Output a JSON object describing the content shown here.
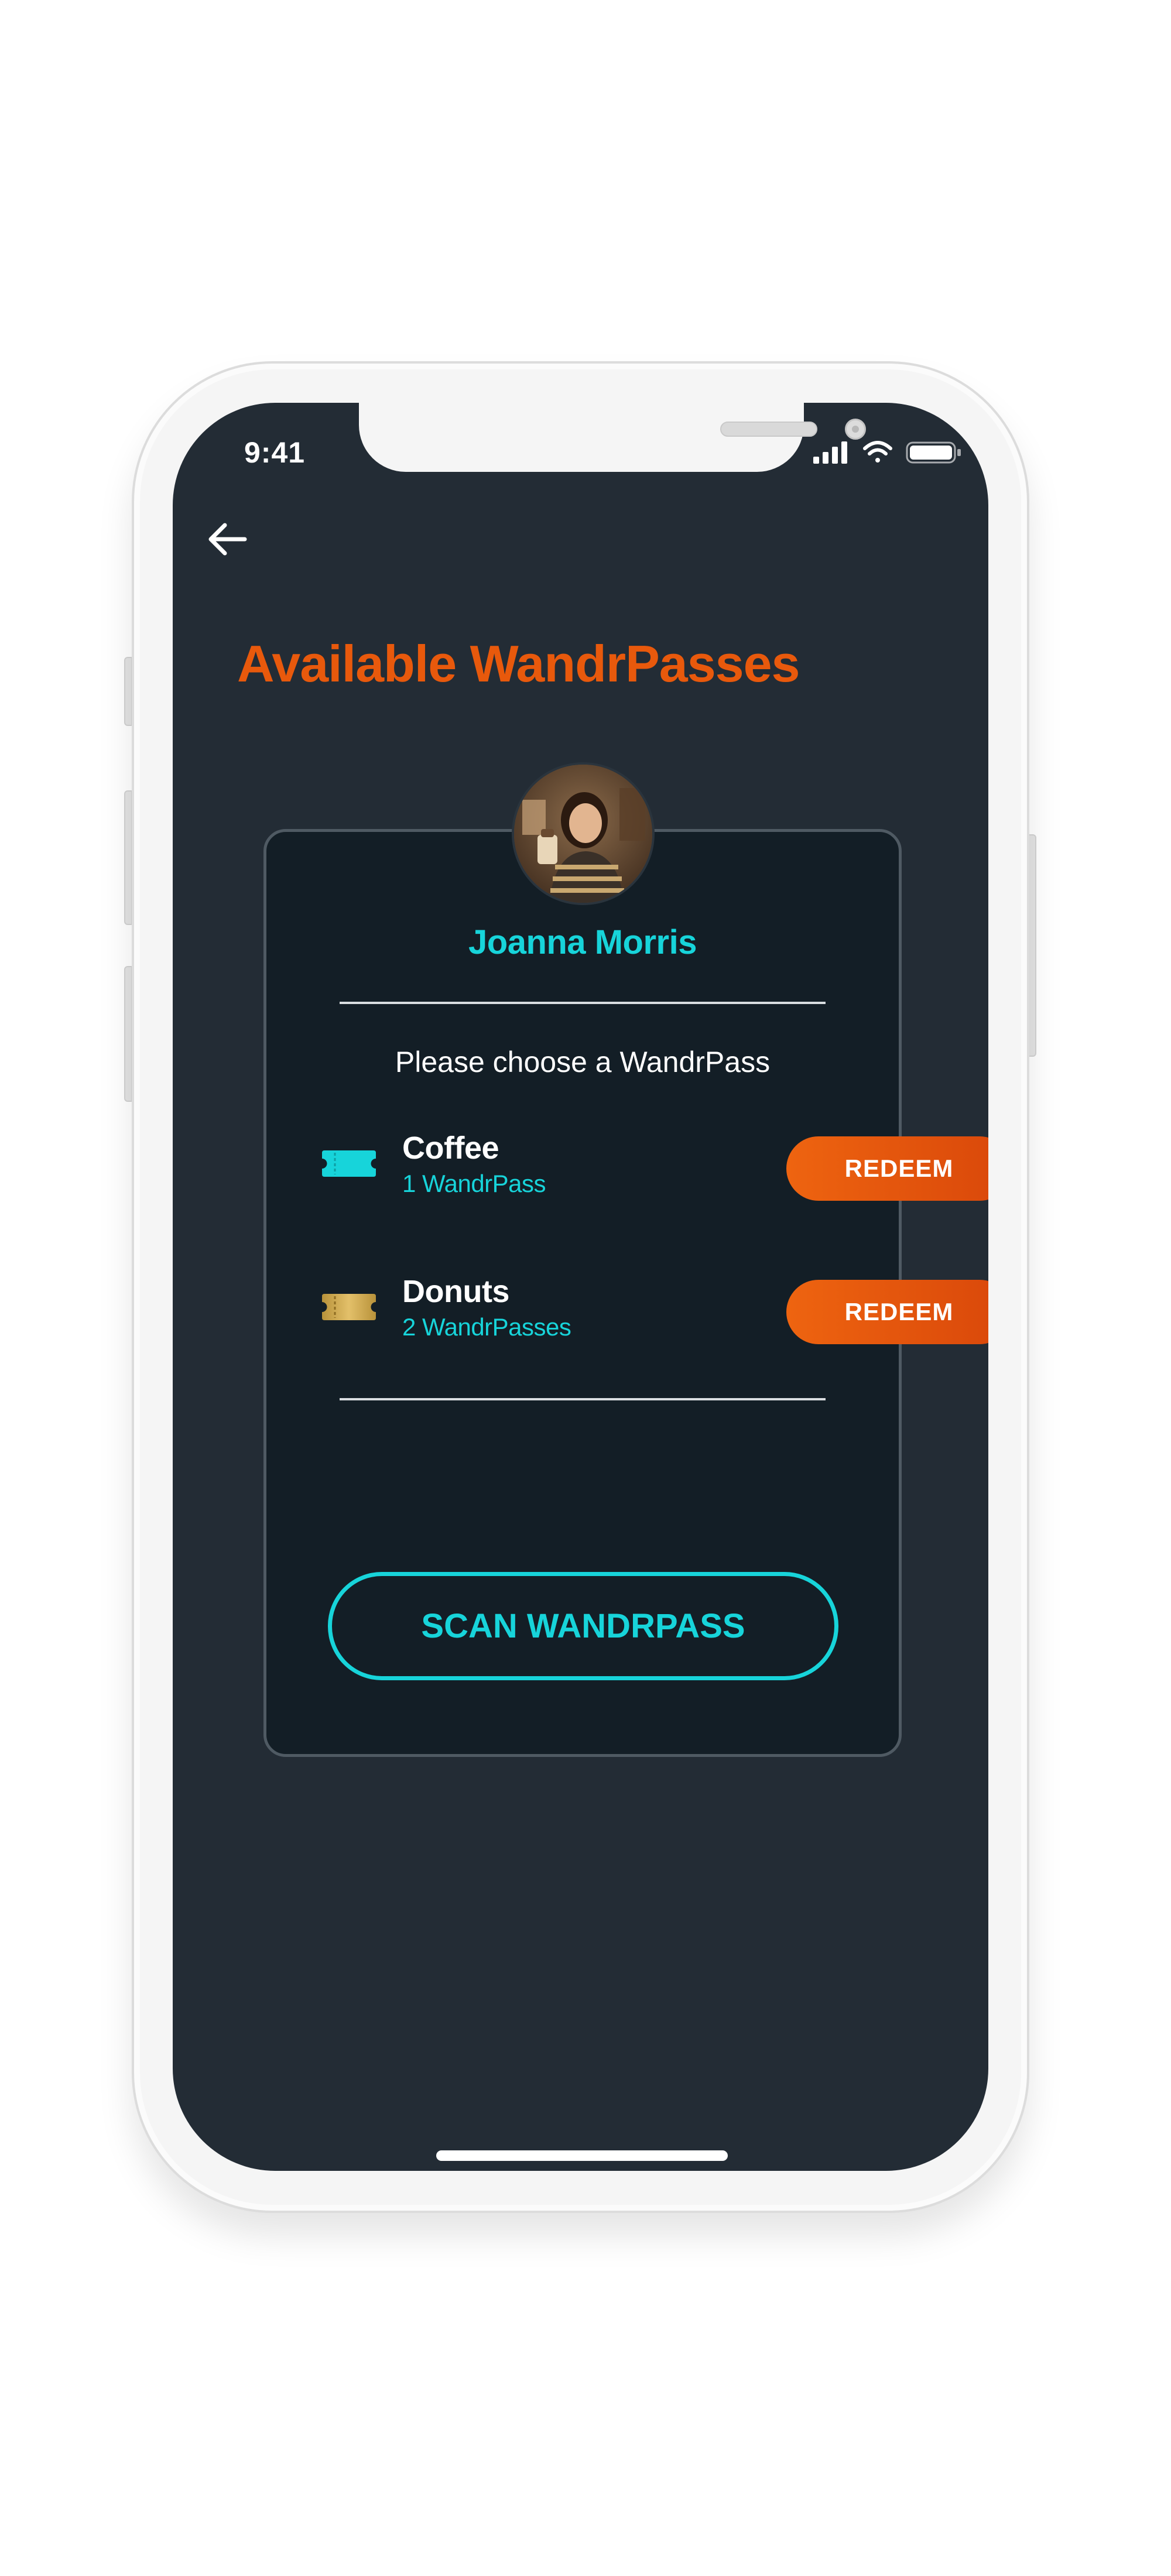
{
  "status_bar": {
    "time": "9:41",
    "icons": [
      "cellular-signal-icon",
      "wifi-icon",
      "battery-icon"
    ]
  },
  "header": {
    "back_icon": "arrow-left-icon",
    "title": "Available WandrPasses"
  },
  "profile": {
    "name": "Joanna Morris",
    "avatar": "avatar-photo"
  },
  "card": {
    "prompt": "Please choose a WandrPass",
    "passes": [
      {
        "name": "Coffee",
        "count": "1 WandrPass",
        "icon": "ticket-icon",
        "icon_color": "#17d4da",
        "action_label": "REDEEM"
      },
      {
        "name": "Donuts",
        "count": "2 WandrPasses",
        "icon": "ticket-icon",
        "icon_color": "#c9a43c",
        "action_label": "REDEEM"
      }
    ],
    "scan_label": "SCAN WANDRPASS"
  },
  "colors": {
    "accent_orange": "#e8590c",
    "accent_cyan": "#17d4da",
    "screen_bg": "#232c35",
    "card_bg": "#131e26"
  }
}
